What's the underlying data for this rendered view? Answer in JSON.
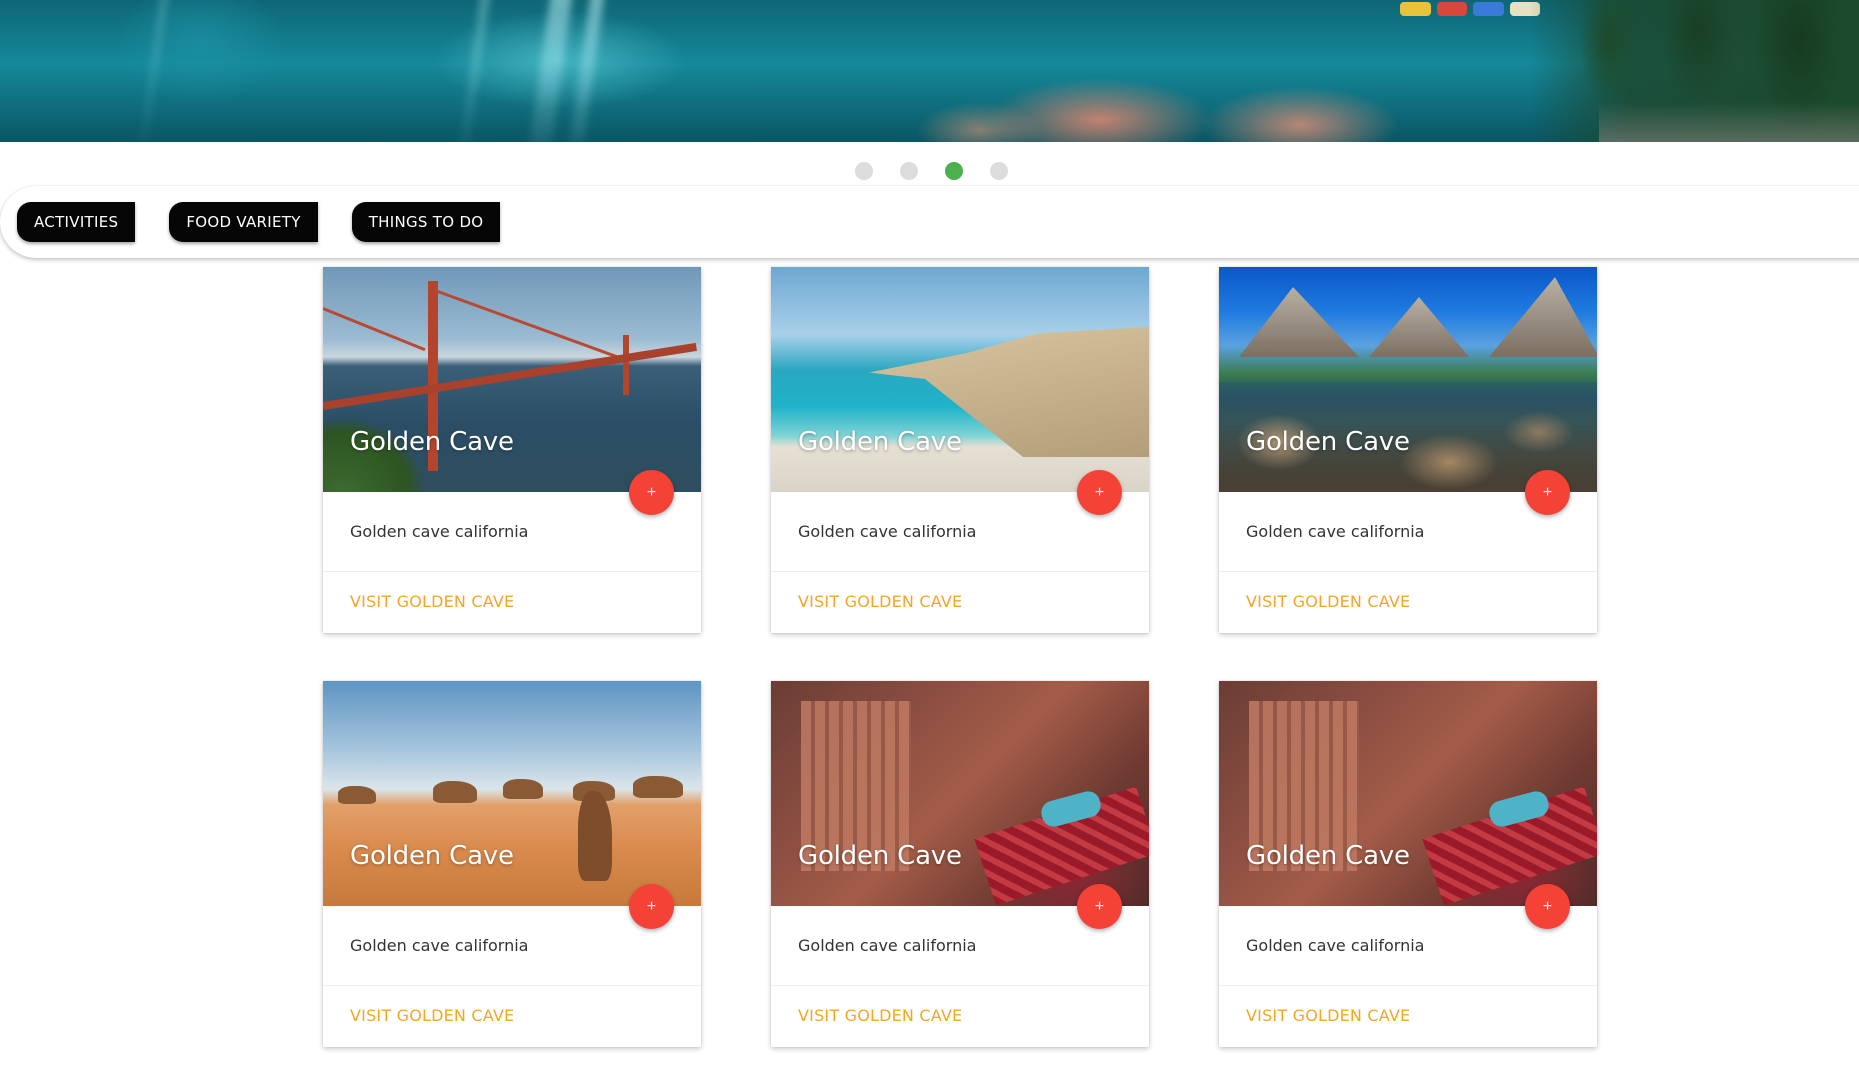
{
  "carousel": {
    "dots": [
      {
        "label": "slide-1",
        "active": false
      },
      {
        "label": "slide-2",
        "active": false
      },
      {
        "label": "slide-3",
        "active": true
      },
      {
        "label": "slide-4",
        "active": false
      }
    ]
  },
  "filters": {
    "activities": "ACTIVITIES",
    "food_variety": "FOOD VARIETY",
    "things_to_do": "THINGS TO DO"
  },
  "cards": [
    {
      "title": "Golden Cave",
      "description": "Golden cave california",
      "action": "VISIT GOLDEN CAVE",
      "fab": "+",
      "scene": "golden-gate-bridge"
    },
    {
      "title": "Golden Cave",
      "description": "Golden cave california",
      "action": "VISIT GOLDEN CAVE",
      "fab": "+",
      "scene": "beach-cove"
    },
    {
      "title": "Golden Cave",
      "description": "Golden cave california",
      "action": "VISIT GOLDEN CAVE",
      "fab": "+",
      "scene": "mountain-lake"
    },
    {
      "title": "Golden Cave",
      "description": "Golden cave california",
      "action": "VISIT GOLDEN CAVE",
      "fab": "+",
      "scene": "desert-camels"
    },
    {
      "title": "Golden Cave",
      "description": "Golden cave california",
      "action": "VISIT GOLDEN CAVE",
      "fab": "+",
      "scene": "petra"
    },
    {
      "title": "Golden Cave",
      "description": "Golden cave california",
      "action": "VISIT GOLDEN CAVE",
      "fab": "+",
      "scene": "petra"
    }
  ],
  "colors": {
    "accent_link": "#f6a623",
    "fab": "#f44336",
    "dot_active": "#4caf50",
    "dot_inactive": "#dcdcdc",
    "pill_bg": "#050505"
  }
}
